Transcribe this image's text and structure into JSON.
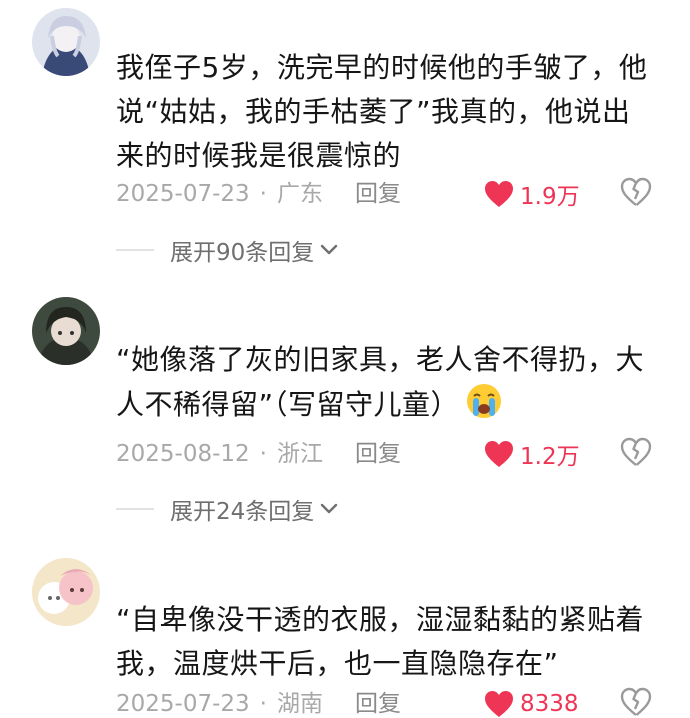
{
  "comments": [
    {
      "text": "我侄子5岁，洗完早的时候他的手皱了，他说“姑姑，我的手枯萎了”我真的，他说出来的时候我是很震惊的",
      "date": "2025-07-23",
      "region": "广东",
      "reply_label": "回复",
      "likes": "1.9万",
      "expand_label": "展开90条回复"
    },
    {
      "text": "“她像落了灰的旧家具，老人舍不得扔，大人不稀得留”（写留守儿童）",
      "date": "2025-08-12",
      "region": "浙江",
      "reply_label": "回复",
      "likes": "1.2万",
      "expand_label": "展开24条回复"
    },
    {
      "text": "“自卑像没干透的衣服，湿湿黏黏的紧贴着我，温度烘干后，也一直隐隐存在”",
      "date": "2025-07-23",
      "region": "湖南",
      "reply_label": "回复",
      "likes": "8338"
    }
  ],
  "separator": "·",
  "icons": {
    "like": "heart-icon",
    "dislike": "broken-heart-icon",
    "expand": "chevron-down-icon",
    "emoji": "loudly-crying-face-emoji"
  },
  "colors": {
    "like": "#ee3556",
    "text": "#161616",
    "meta": "#a8a8a8"
  }
}
